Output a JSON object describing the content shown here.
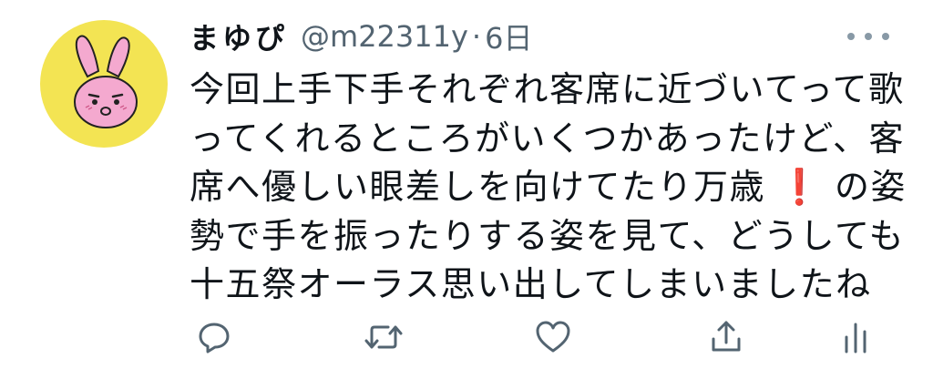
{
  "user": {
    "display_name": "まゆぴ",
    "handle": "@m22311y",
    "separator": "·",
    "timestamp": "6日"
  },
  "tweet": {
    "line1": "今回上手下手それぞれ客席に近づいてって歌",
    "line2": "ってくれるところがいくつかあったけど、客",
    "line3_a": "席へ優しい眼差しを向けてたり万歳",
    "line3_emoji": "❗",
    "line3_b": "の姿",
    "line4": "勢で手を振ったりする姿を見て、どうしても",
    "line5": "十五祭オーラス思い出してしまいましたね"
  },
  "icons": {
    "avatar": "pink-rabbit-avatar",
    "more": "more-icon",
    "reply": "reply-icon",
    "retweet": "retweet-icon",
    "like": "like-icon",
    "share": "share-icon",
    "analytics": "analytics-icon"
  },
  "colors": {
    "text": "#0f1419",
    "secondary": "#536471",
    "icon": "#536471",
    "avatar_bg": "#f3e453",
    "rabbit": "#f4a9cf",
    "exclaim": "#e0162b"
  }
}
